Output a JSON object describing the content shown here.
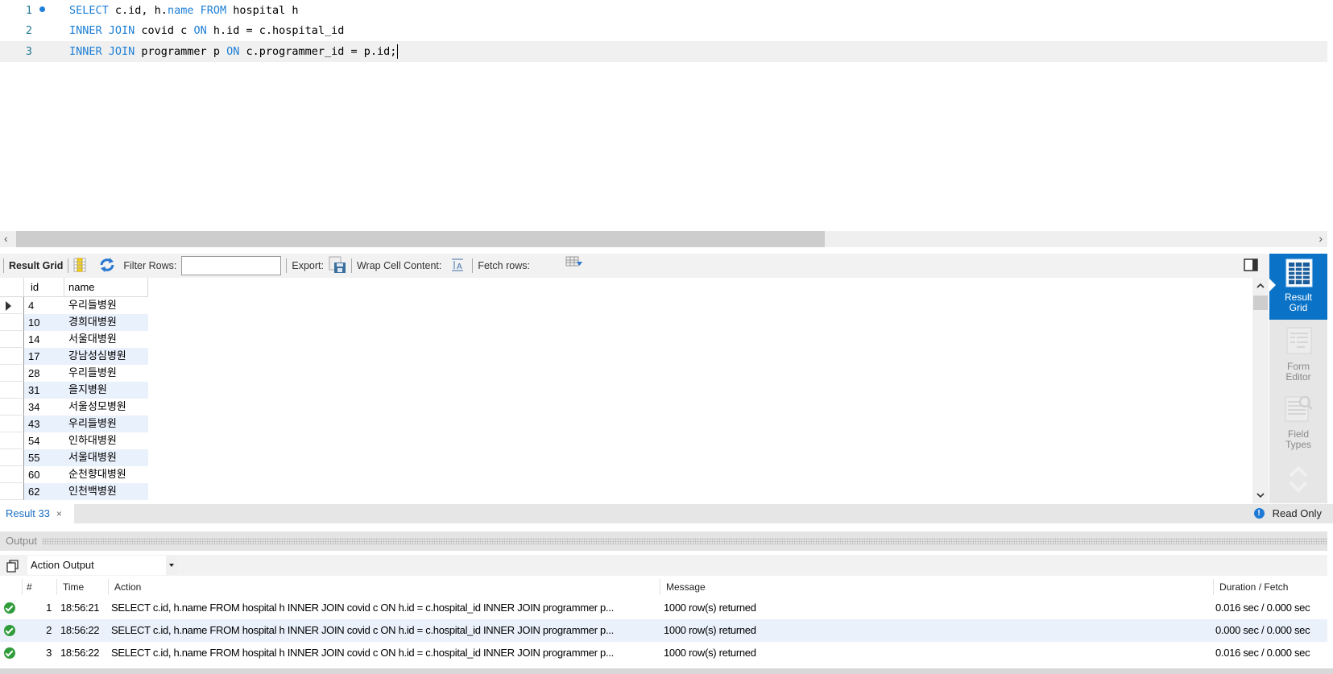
{
  "editor": {
    "lines": [
      {
        "number": "1",
        "tokens": [
          {
            "t": "SELECT",
            "kw": true
          },
          {
            "t": " c.id, h."
          },
          {
            "t": "name",
            "kw": true
          },
          {
            "t": " "
          },
          {
            "t": "FROM",
            "kw": true
          },
          {
            "t": " hospital h"
          }
        ]
      },
      {
        "number": "2",
        "tokens": [
          {
            "t": "INNER JOIN",
            "kw": true
          },
          {
            "t": " covid c "
          },
          {
            "t": "ON",
            "kw": true
          },
          {
            "t": " h.id = c.hospital_id"
          }
        ]
      },
      {
        "number": "3",
        "tokens": [
          {
            "t": "INNER JOIN",
            "kw": true
          },
          {
            "t": " programmer p "
          },
          {
            "t": "ON",
            "kw": true
          },
          {
            "t": " c.programmer_id = p.id;"
          }
        ]
      }
    ]
  },
  "result_toolbar": {
    "result_grid_label": "Result Grid",
    "filter_rows_label": "Filter Rows:",
    "filter_rows_value": "",
    "export_label": "Export:",
    "wrap_cell_label": "Wrap Cell Content:",
    "fetch_rows_label": "Fetch rows:"
  },
  "grid": {
    "columns": [
      "id",
      "name"
    ],
    "rows": [
      {
        "id": "4",
        "name": "우리들병원"
      },
      {
        "id": "10",
        "name": "경희대병원"
      },
      {
        "id": "14",
        "name": "서울대병원"
      },
      {
        "id": "17",
        "name": "강남성심병원"
      },
      {
        "id": "28",
        "name": "우리들병원"
      },
      {
        "id": "31",
        "name": "을지병원"
      },
      {
        "id": "34",
        "name": "서울성모병원"
      },
      {
        "id": "43",
        "name": "우리들병원"
      },
      {
        "id": "54",
        "name": "인하대병원"
      },
      {
        "id": "55",
        "name": "서울대병원"
      },
      {
        "id": "60",
        "name": "순천향대병원"
      },
      {
        "id": "62",
        "name": "인천백병원"
      }
    ]
  },
  "side_panel": {
    "result_grid": "Result Grid",
    "form_editor": "Form Editor",
    "field_types": "Field Types"
  },
  "result_tab": {
    "label": "Result 33",
    "close": "×",
    "read_only": "Read Only"
  },
  "output": {
    "title": "Output",
    "selector": "Action Output",
    "columns": [
      "#",
      "Time",
      "Action",
      "Message",
      "Duration / Fetch"
    ],
    "rows": [
      {
        "num": "1",
        "time": "18:56:21",
        "action": "SELECT c.id, h.name FROM hospital h  INNER JOIN covid c ON h.id = c.hospital_id INNER JOIN programmer p...",
        "message": "1000 row(s) returned",
        "duration": "0.016 sec / 0.000 sec",
        "status": "success"
      },
      {
        "num": "2",
        "time": "18:56:22",
        "action": "SELECT c.id, h.name FROM hospital h  INNER JOIN covid c ON h.id = c.hospital_id INNER JOIN programmer p...",
        "message": "1000 row(s) returned",
        "duration": "0.000 sec / 0.000 sec",
        "status": "success"
      },
      {
        "num": "3",
        "time": "18:56:22",
        "action": "SELECT c.id, h.name FROM hospital h  INNER JOIN covid c ON h.id = c.hospital_id INNER JOIN programmer p...",
        "message": "1000 row(s) returned",
        "duration": "0.016 sec / 0.000 sec",
        "status": "success"
      }
    ]
  },
  "colors": {
    "accent": "#0a73c8",
    "keyword": "#1d7fd6",
    "success": "#2f9c3a"
  }
}
